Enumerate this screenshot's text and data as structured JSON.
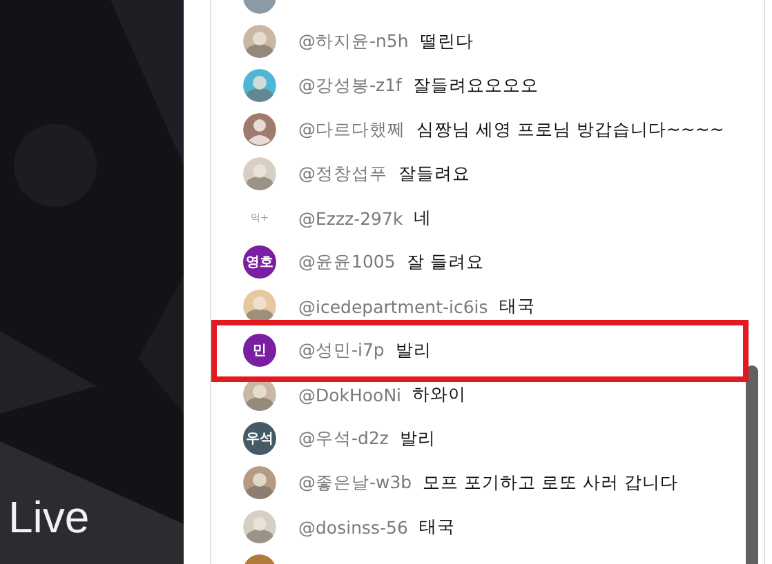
{
  "video": {
    "kind": "picture",
    "caption": "Live"
  },
  "chat": {
    "messages": [
      {
        "author": "@하지윤-n5h",
        "text": "떨린다"
      },
      {
        "author": "@강성봉-z1f",
        "text": "잘들려요오오오"
      },
      {
        "author": "@다르다했쩨",
        "text": "심짱님 세영 프로님 방갑습니다~~~~",
        "avatar": {
          "kind": "default"
        }
      },
      {
        "author": "@정창섭푸",
        "text": "잘들려요"
      },
      {
        "author": "@Ezzz-297k",
        "text": "네",
        "avatar": {
          "kind": "mini",
          "initials": "먹+"
        }
      },
      {
        "author": "@윤윤1005",
        "text": "잘 들려요",
        "avatar": {
          "kind": "initials",
          "initials": "영호",
          "color": "#7b1fa2"
        }
      },
      {
        "author": "@icedepartment-ic6is",
        "text": "태국"
      },
      {
        "author": "@성민-i7p",
        "text": "발리",
        "avatar": {
          "kind": "initials",
          "initials": "민",
          "color": "#7b1fa2"
        }
      },
      {
        "author": "@DokHooNi",
        "text": "하와이"
      },
      {
        "author": "@우석-d2z",
        "text": "발리",
        "avatar": {
          "kind": "initials",
          "initials": "우석",
          "color": "#455a64"
        }
      },
      {
        "author": "@좋은날-w3b",
        "text": "모프 포기하고 로또 사러 갑니다"
      },
      {
        "author": "@dosinss-56",
        "text": "태국"
      }
    ]
  }
}
